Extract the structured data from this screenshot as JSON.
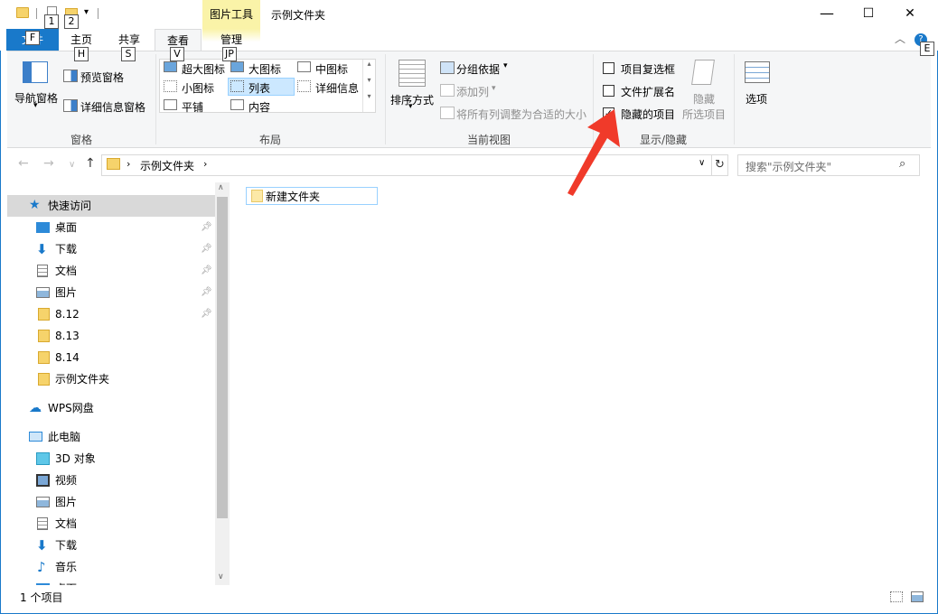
{
  "window": {
    "title": "示例文件夹",
    "context_header": "图片工具",
    "minimize": "—",
    "maximize": "☐",
    "close": "✕"
  },
  "keytips": [
    "1",
    "2",
    "F",
    "H",
    "S",
    "V",
    "JP",
    "E"
  ],
  "tabs": {
    "file": "文件",
    "home": "主页",
    "share": "共享",
    "view": "查看",
    "manage": "管理"
  },
  "ribbon": {
    "panes": {
      "nav_pane": "导航窗格",
      "preview_pane": "预览窗格",
      "details_pane": "详细信息窗格",
      "group": "窗格"
    },
    "layout": {
      "extra_large": "超大图标",
      "large": "大图标",
      "medium": "中图标",
      "small": "小图标",
      "list": "列表",
      "details": "详细信息",
      "tiles": "平铺",
      "content": "内容",
      "group": "布局"
    },
    "current_view": {
      "sort_by": "排序方式",
      "group_by": "分组依据",
      "add_columns": "添加列",
      "size_all_columns": "将所有列调整为合适的大小",
      "group": "当前视图"
    },
    "show_hide": {
      "item_checkboxes": "项目复选框",
      "file_extensions": "文件扩展名",
      "hidden_items": "隐藏的项目",
      "hide_selected_1": "隐藏",
      "hide_selected_2": "所选项目",
      "group": "显示/隐藏",
      "checked": {
        "item_checkboxes": false,
        "file_extensions": false,
        "hidden_items": true
      }
    },
    "options": "选项"
  },
  "address": {
    "path_folder": "示例文件夹",
    "search_placeholder": "搜索\"示例文件夹\""
  },
  "nav": {
    "quick_access": "快速访问",
    "items": [
      {
        "label": "桌面"
      },
      {
        "label": "下载"
      },
      {
        "label": "文档"
      },
      {
        "label": "图片"
      },
      {
        "label": "8.12"
      },
      {
        "label": "8.13"
      },
      {
        "label": "8.14"
      },
      {
        "label": "示例文件夹"
      }
    ],
    "wps": "WPS网盘",
    "this_pc": "此电脑",
    "pc_items": [
      {
        "label": "3D 对象"
      },
      {
        "label": "视频"
      },
      {
        "label": "图片"
      },
      {
        "label": "文档"
      },
      {
        "label": "下载"
      },
      {
        "label": "音乐"
      },
      {
        "label": "桌面"
      }
    ]
  },
  "content": {
    "items": [
      {
        "label": "新建文件夹"
      }
    ]
  },
  "status": {
    "count": "1 个项目"
  },
  "colors": {
    "accent": "#1979ca",
    "context_tab": "#faf3a8",
    "annotation_arrow": "#f03a2a"
  }
}
